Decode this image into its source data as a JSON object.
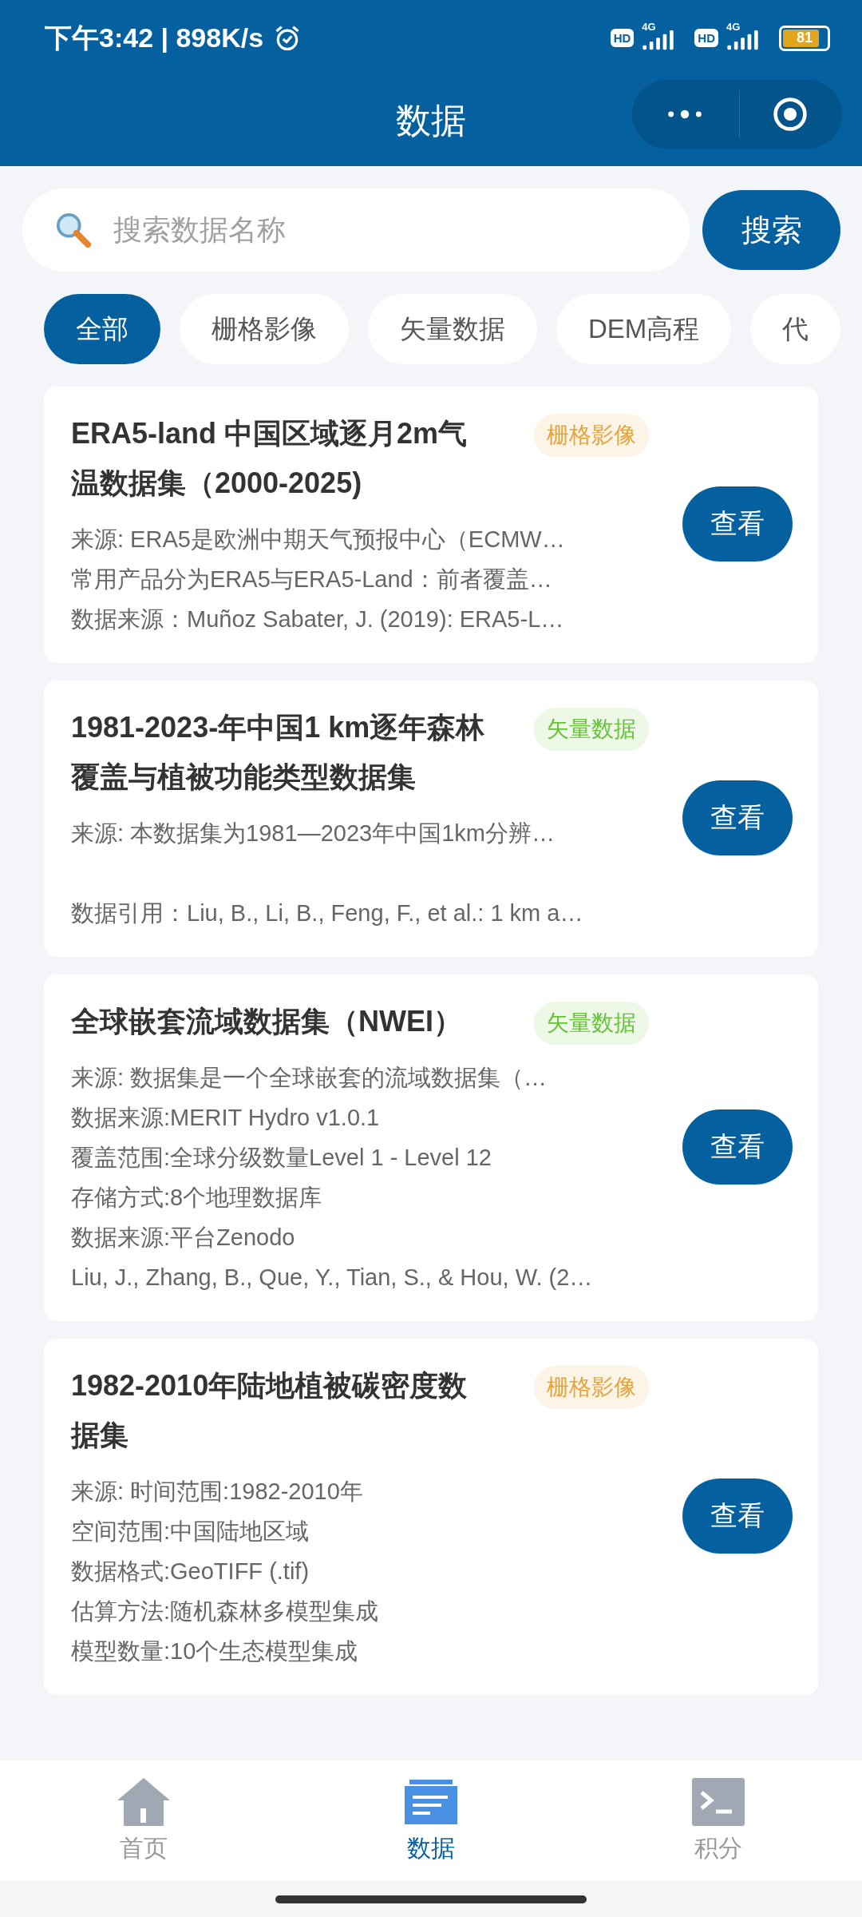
{
  "status_bar": {
    "time": "下午3:42 | 898K/s",
    "networks": [
      {
        "badge": "HD",
        "type": "4G"
      },
      {
        "badge": "HD",
        "type": "4G"
      }
    ],
    "battery": {
      "text": "81"
    }
  },
  "nav_bar": {
    "title": "数据"
  },
  "search": {
    "placeholder": "搜索数据名称",
    "button": "搜索"
  },
  "filters": [
    {
      "label": "全部",
      "selected": true
    },
    {
      "label": "栅格影像",
      "selected": false
    },
    {
      "label": "矢量数据",
      "selected": false
    },
    {
      "label": "DEM高程",
      "selected": false
    },
    {
      "label": "代",
      "selected": false
    }
  ],
  "cards": [
    {
      "title": "ERA5-land 中国区域逐月2m气温数据集（2000-2025)",
      "tag": {
        "label": "栅格影像",
        "color": "#e6a23c"
      },
      "paragraphs": [
        [
          "来源: ERA5是欧洲中期天气预报中心（ECMW…",
          "常用产品分为ERA5与ERA5-Land：前者覆盖…",
          "数据来源：Muñoz Sabater, J. (2019): ERA5-L…"
        ]
      ],
      "button": "查看"
    },
    {
      "title": "1981-2023-年中国1 km逐年森林覆盖与植被功能类型数据集",
      "tag": {
        "label": "矢量数据",
        "color": "#67c23a"
      },
      "paragraphs": [
        [
          "来源: 本数据集为1981—2023年中国1km分辨…"
        ],
        [
          "数据引用：Liu, B., Li, B., Feng, F., et al.: 1 km a…"
        ]
      ],
      "button": "查看"
    },
    {
      "title": "全球嵌套流域数据集（NWEI）",
      "tag": {
        "label": "矢量数据",
        "color": "#67c23a"
      },
      "paragraphs": [
        [
          "来源: 数据集是一个全球嵌套的流域数据集（…",
          "数据来源:MERIT Hydro v1.0.1",
          "覆盖范围:全球分级数量Level 1 - Level 12",
          "存储方式:8个地理数据库",
          "数据来源:平台Zenodo",
          "Liu, J., Zhang, B., Que, Y., Tian, S., & Hou, W. (2…"
        ]
      ],
      "button": "查看"
    },
    {
      "title": "1982-2010年陆地植被碳密度数据集",
      "tag": {
        "label": "栅格影像",
        "color": "#e6a23c"
      },
      "paragraphs": [
        [
          "来源: 时间范围:1982-2010年",
          "空间范围:中国陆地区域",
          "数据格式:GeoTIFF (.tif)",
          "估算方法:随机森林多模型集成",
          "模型数量:10个生态模型集成"
        ]
      ],
      "button": "查看"
    }
  ],
  "tab_bar": [
    {
      "label": "首页",
      "selected": false
    },
    {
      "label": "数据",
      "selected": true
    },
    {
      "label": "积分",
      "selected": false
    }
  ]
}
